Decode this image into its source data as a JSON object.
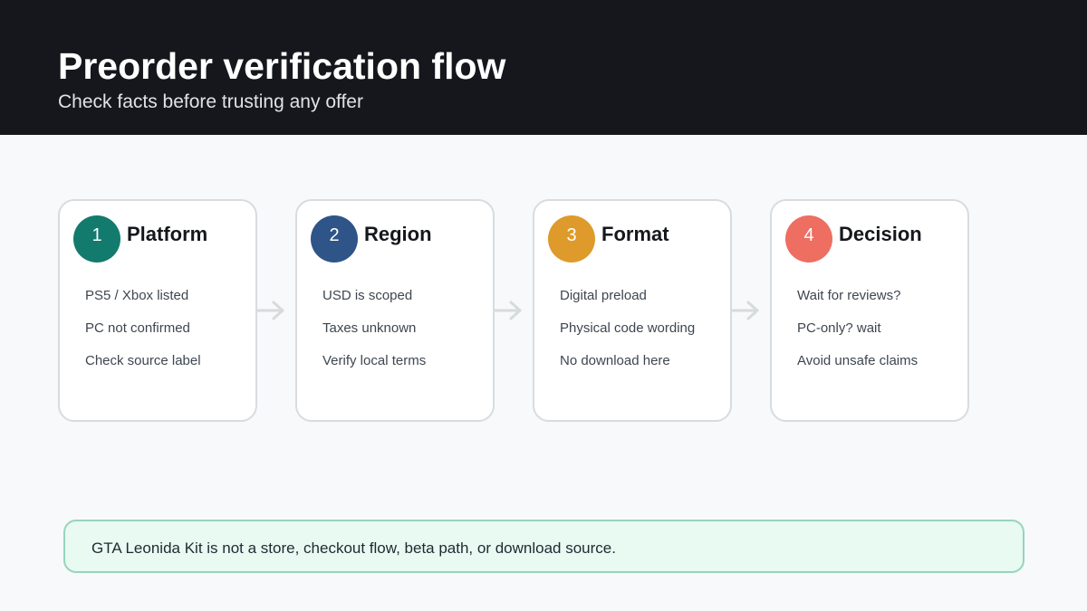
{
  "header": {
    "title": "Preorder verification flow",
    "subtitle": "Check facts before trusting any offer"
  },
  "steps": [
    {
      "number": "1",
      "title": "Platform",
      "color": "#137a6e",
      "items": [
        "PS5 / Xbox listed",
        "PC not confirmed",
        "Check source label"
      ]
    },
    {
      "number": "2",
      "title": "Region",
      "color": "#2f5487",
      "items": [
        "USD is scoped",
        "Taxes unknown",
        "Verify local terms"
      ]
    },
    {
      "number": "3",
      "title": "Format",
      "color": "#de9a2a",
      "items": [
        "Digital preload",
        "Physical code wording",
        "No download here"
      ]
    },
    {
      "number": "4",
      "title": "Decision",
      "color": "#ee6e62",
      "items": [
        "Wait for reviews?",
        "PC-only? wait",
        "Avoid unsafe claims"
      ]
    }
  ],
  "connector_icon": "arrow-right-icon",
  "note": {
    "text": "GTA Leonida Kit is not a store, checkout flow, beta path, or download source."
  }
}
